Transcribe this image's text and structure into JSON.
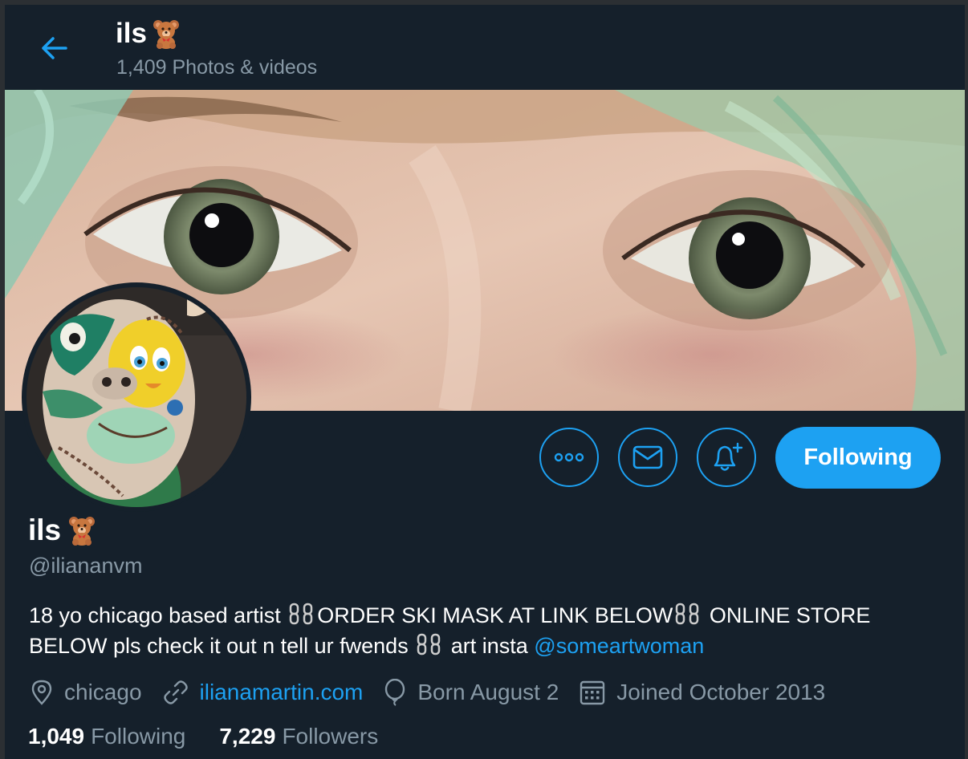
{
  "header": {
    "title": "ils",
    "title_emoji": "teddy-bear-icon",
    "subtitle": "1,409 Photos & videos"
  },
  "profile": {
    "name": "ils",
    "handle": "@iliananvm",
    "bio_parts": {
      "part1": "18 yo chicago based artist",
      "part2": "ORDER SKI MASK AT LINK BELOW",
      "part3": " ONLINE STORE BELOW pls check it out n tell ur fwends",
      "part4": " art insta",
      "mention": "@someartwoman"
    },
    "location": "chicago",
    "website": "ilianamartin.com",
    "birthday": "Born August 2",
    "joined": "Joined October 2013"
  },
  "actions": {
    "follow_label": "Following",
    "more_icon": "more-icon",
    "message_icon": "mail-icon",
    "notify_icon": "bell-plus-icon"
  },
  "stats": {
    "following_count": "1,049",
    "following_label": "Following",
    "followers_count": "7,229",
    "followers_label": "Followers"
  },
  "colors": {
    "background": "#15202b",
    "accent": "#1da1f2",
    "secondary_text": "#8899a6"
  }
}
